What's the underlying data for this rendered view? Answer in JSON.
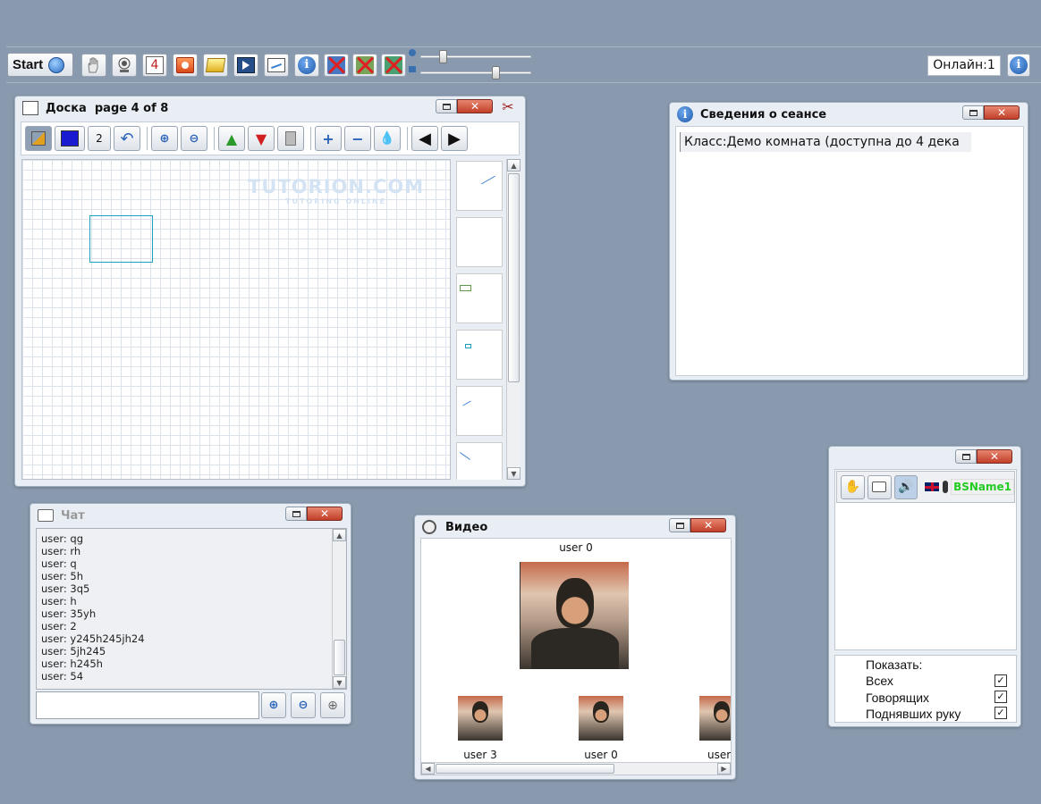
{
  "toolbar": {
    "start_label": "Start",
    "page_counter": "4",
    "online_label": "Онлайн:1"
  },
  "board": {
    "title": "Доска  page 4 of 8",
    "pen_size": "2",
    "watermark": "TUTORION.COM",
    "watermark_sub": "TUTORING ONLINE"
  },
  "session": {
    "title": "Сведения о сеансе",
    "class_text": "Класс:Демо комната (доступна до 4 дека"
  },
  "chat": {
    "title": "Чат",
    "messages": [
      "user: qg",
      "user: rh",
      "user: q",
      "user: 5h",
      "user: 3q5",
      "user: h",
      "user: 35yh",
      "user: 2",
      "user: y245h245jh24",
      "user: 5jh245",
      "user: h245h",
      "user: 54"
    ],
    "input_value": ""
  },
  "video": {
    "title": "Видео",
    "main_user": "user 0",
    "thumbs": [
      "user 3",
      "user 0",
      "user"
    ]
  },
  "users": {
    "username": "BSName1",
    "show_label": "Показать:",
    "filters": [
      {
        "label": "Всех",
        "checked": true
      },
      {
        "label": "Говорящих",
        "checked": true
      },
      {
        "label": "Поднявших руку",
        "checked": true
      }
    ]
  },
  "colors": {
    "background": "#8a9aae",
    "close_button": "#c2402a",
    "username_green": "#22cc22",
    "info_blue": "#1e5aa8"
  }
}
